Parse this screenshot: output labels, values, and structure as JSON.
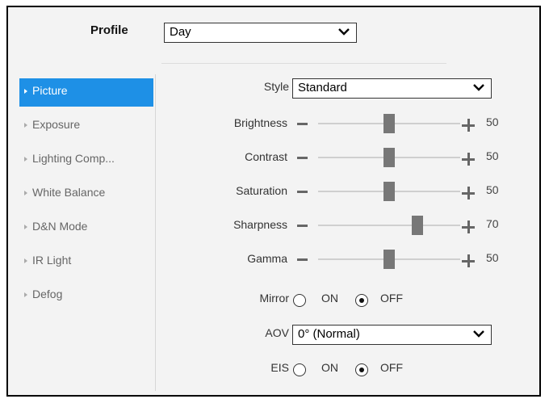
{
  "profile": {
    "label": "Profile",
    "value": "Day"
  },
  "sidebar": {
    "items": [
      {
        "label": "Picture",
        "active": true
      },
      {
        "label": "Exposure",
        "active": false
      },
      {
        "label": "Lighting Comp...",
        "active": false
      },
      {
        "label": "White Balance",
        "active": false
      },
      {
        "label": "D&N Mode",
        "active": false
      },
      {
        "label": "IR Light",
        "active": false
      },
      {
        "label": "Defog",
        "active": false
      }
    ]
  },
  "style": {
    "label": "Style",
    "value": "Standard"
  },
  "sliders": [
    {
      "label": "Brightness",
      "value": "50",
      "fraction": 0.5
    },
    {
      "label": "Contrast",
      "value": "50",
      "fraction": 0.5
    },
    {
      "label": "Saturation",
      "value": "50",
      "fraction": 0.5
    },
    {
      "label": "Sharpness",
      "value": "70",
      "fraction": 0.7
    },
    {
      "label": "Gamma",
      "value": "50",
      "fraction": 0.5
    }
  ],
  "mirror": {
    "label": "Mirror",
    "on_label": "ON",
    "off_label": "OFF",
    "selected": "OFF"
  },
  "aov": {
    "label": "AOV",
    "value": "0° (Normal)"
  },
  "eis": {
    "label": "EIS",
    "on_label": "ON",
    "off_label": "OFF",
    "selected": "OFF"
  },
  "colors": {
    "active_item": "#1e90e6",
    "thumb": "#777777",
    "frame_bg": "#f3f3f3"
  }
}
